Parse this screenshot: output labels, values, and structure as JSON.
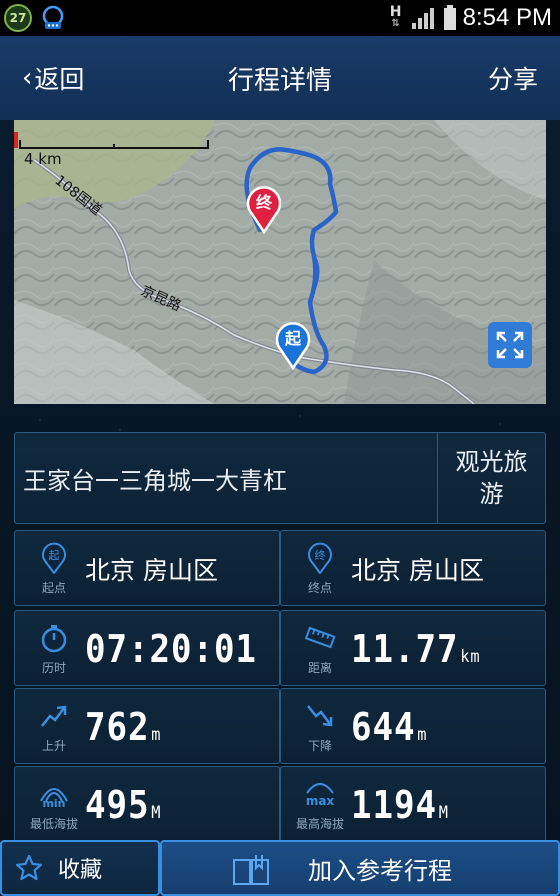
{
  "status_bar": {
    "badge_number": "27",
    "network": "H",
    "time": "8:54 PM"
  },
  "nav": {
    "back_label": "返回",
    "title": "行程详情",
    "share_label": "分享"
  },
  "map": {
    "scale_label": "4 km",
    "road_labels": [
      "108国道",
      "京昆路"
    ],
    "start_marker": "起",
    "end_marker": "终",
    "route_color": "#2a64c8"
  },
  "route": {
    "name": "王家台一三角城一大青杠",
    "type": "观光旅游"
  },
  "stats": {
    "start": {
      "label": "起点",
      "icon": "start-pin-icon",
      "value": "北京 房山区"
    },
    "end": {
      "label": "终点",
      "icon": "end-pin-icon",
      "value": "北京 房山区"
    },
    "duration": {
      "label": "历时",
      "icon": "stopwatch-icon",
      "value": "07:20:01"
    },
    "distance": {
      "label": "距离",
      "icon": "ruler-icon",
      "value": "11.77",
      "unit": "km"
    },
    "ascent": {
      "label": "上升",
      "icon": "trend-up-icon",
      "value": "762",
      "unit": "m"
    },
    "descent": {
      "label": "下降",
      "icon": "trend-down-icon",
      "value": "644",
      "unit": "m"
    },
    "min_altitude": {
      "label": "最低海拔",
      "icon": "min-altitude-icon",
      "icon_text": "min",
      "value": "495",
      "unit": "M"
    },
    "max_altitude": {
      "label": "最高海拔",
      "icon": "max-altitude-icon",
      "icon_text": "max",
      "value": "1194",
      "unit": "M"
    }
  },
  "bottom": {
    "favorite_label": "收藏",
    "add_reference_label": "加入参考行程"
  },
  "colors": {
    "accent": "#3a8ee0",
    "navbar": "#183b67",
    "background": "#061624"
  }
}
